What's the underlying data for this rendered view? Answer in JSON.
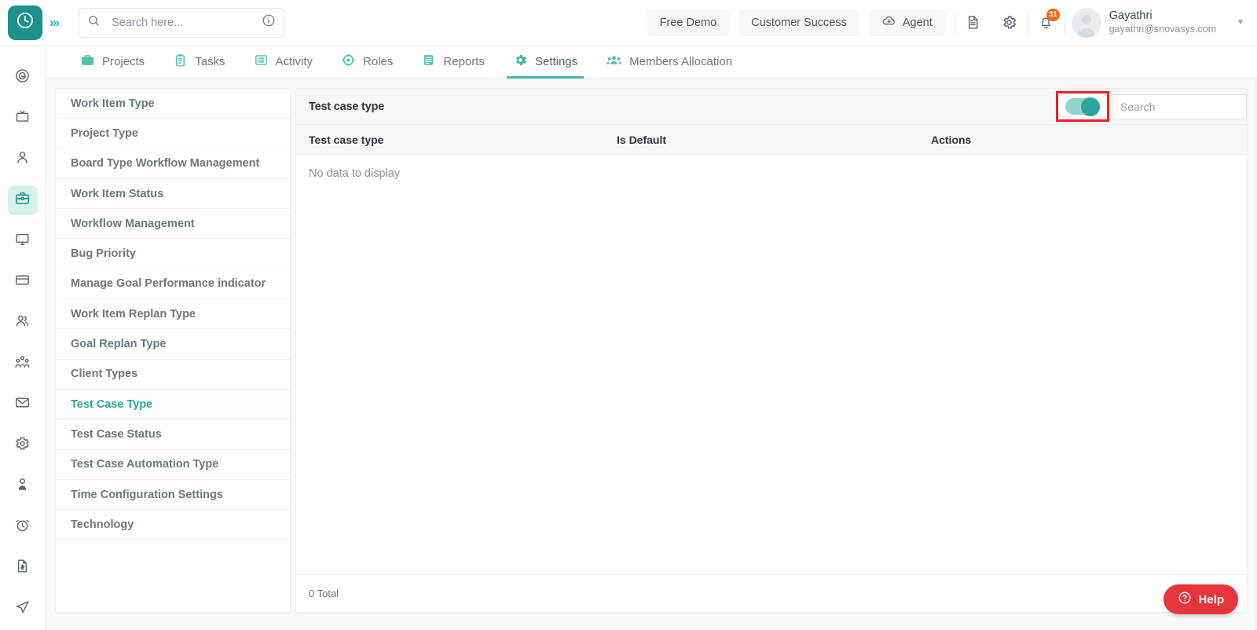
{
  "header": {
    "logo_icon": "clock-logo-icon",
    "expand_icon": "double-chevron-right-icon",
    "search": {
      "placeholder": "Search here...",
      "value": "",
      "icon": "search-icon",
      "info_icon": "info-circle-icon"
    },
    "free_demo_label": "Free Demo",
    "customer_success_label": "Customer Success",
    "agent_label": "Agent",
    "agent_icon": "cloud-download-icon",
    "doc_icon": "document-icon",
    "settings_icon": "gear-icon",
    "notification_icon": "bell-icon",
    "notification_count": "31",
    "avatar_icon": "avatar",
    "user_name": "Gayathri",
    "user_email": "gayathri@snovasys.com",
    "caret_icon": "chevron-down-icon"
  },
  "nav": {
    "tabs": [
      {
        "label": "Projects",
        "icon": "briefcase-icon",
        "active": false
      },
      {
        "label": "Tasks",
        "icon": "clipboard-icon",
        "active": false
      },
      {
        "label": "Activity",
        "icon": "list-box-icon",
        "active": false
      },
      {
        "label": "Roles",
        "icon": "target-icon",
        "active": false
      },
      {
        "label": "Reports",
        "icon": "report-icon",
        "active": false
      },
      {
        "label": "Settings",
        "icon": "gear-icon",
        "active": true
      },
      {
        "label": "Members Allocation",
        "icon": "group-people-icon",
        "active": false
      }
    ]
  },
  "rail": {
    "items": [
      {
        "icon": "spiral-dashboard-icon",
        "active": false
      },
      {
        "icon": "tv-screen-icon",
        "active": false
      },
      {
        "icon": "person-icon",
        "active": false
      },
      {
        "icon": "briefcase-icon",
        "active": true
      },
      {
        "icon": "monitor-icon",
        "active": false
      },
      {
        "icon": "credit-card-icon",
        "active": false
      },
      {
        "icon": "two-people-icon",
        "active": false
      },
      {
        "icon": "team-group-icon",
        "active": false
      },
      {
        "icon": "mail-envelope-icon",
        "active": false
      },
      {
        "icon": "gear-icon",
        "active": false
      },
      {
        "icon": "user-badge-icon",
        "active": false
      },
      {
        "icon": "alarm-clock-icon",
        "active": false
      },
      {
        "icon": "invoice-document-icon",
        "active": false
      },
      {
        "icon": "send-paperplane-icon",
        "active": false
      }
    ]
  },
  "settings_menu": {
    "items": [
      {
        "label": "Work Item Type",
        "active": false
      },
      {
        "label": "Project Type",
        "active": false
      },
      {
        "label": "Board Type Workflow Management",
        "active": false
      },
      {
        "label": "Work Item Status",
        "active": false
      },
      {
        "label": "Workflow Management",
        "active": false
      },
      {
        "label": "Bug Priority",
        "active": false
      },
      {
        "label": "Manage Goal Performance indicator",
        "active": false
      },
      {
        "label": "Work Item Replan Type",
        "active": false
      },
      {
        "label": "Goal Replan Type",
        "active": false
      },
      {
        "label": "Client Types",
        "active": false
      },
      {
        "label": "Test Case Type",
        "active": true
      },
      {
        "label": "Test Case Status",
        "active": false
      },
      {
        "label": "Test Case Automation Type",
        "active": false
      },
      {
        "label": "Time Configuration Settings",
        "active": false
      },
      {
        "label": "Technology",
        "active": false
      }
    ]
  },
  "panel": {
    "title": "Test case type",
    "toggle": {
      "name": "show-inactive-toggle",
      "state": "on",
      "highlighted": true
    },
    "search": {
      "placeholder": "Search",
      "value": "",
      "name": "panel-search-input"
    },
    "columns": [
      "Test case type",
      "Is Default",
      "Actions"
    ],
    "rows": [],
    "empty_message": "No data to display",
    "total_label": "0 Total"
  },
  "help": {
    "label": "Help",
    "icon": "question-circle-icon",
    "color": "#e8353b"
  },
  "colors": {
    "brand_teal": "#1a9189",
    "accent_teal": "#3fb6ab",
    "highlight_red": "#f51f23",
    "badge_orange": "#ef6c1a",
    "panel_bg": "#f7f8f9"
  }
}
